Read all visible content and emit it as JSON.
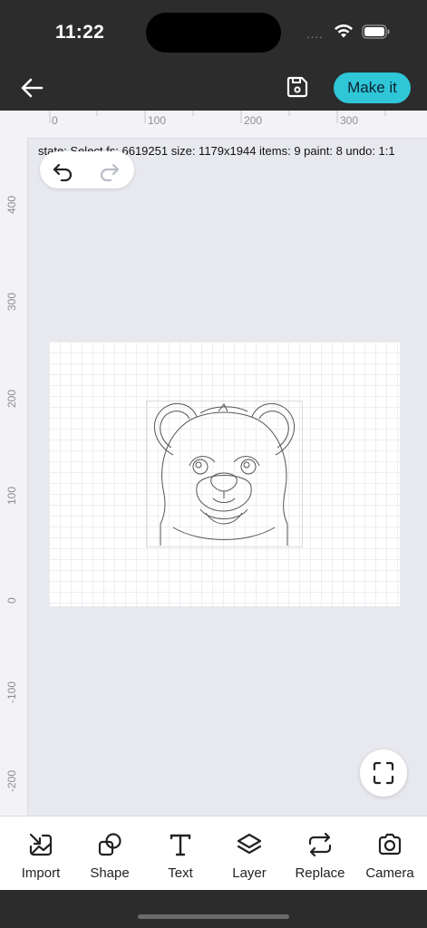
{
  "status_bar": {
    "time": "11:22",
    "signal": "...."
  },
  "header": {
    "make_it_label": "Make it"
  },
  "ruler": {
    "horizontal_labels": [
      "0",
      "100",
      "200",
      "300"
    ],
    "vertical_labels": [
      "400",
      "300",
      "200",
      "100",
      "0",
      "-100",
      "-200"
    ]
  },
  "canvas": {
    "info_text": "state: Select fs: 6619251 size: 1179x1944 items: 9 paint: 8 undo: 1:1"
  },
  "toolbar": {
    "items": [
      {
        "label": "Import",
        "icon": "import-icon"
      },
      {
        "label": "Shape",
        "icon": "shape-icon"
      },
      {
        "label": "Text",
        "icon": "text-icon"
      },
      {
        "label": "Layer",
        "icon": "layer-icon"
      },
      {
        "label": "Replace",
        "icon": "replace-icon"
      },
      {
        "label": "Camera",
        "icon": "camera-icon"
      }
    ]
  },
  "colors": {
    "accent": "#2fc6d8",
    "chrome": "#2c2c2c",
    "canvas_bg": "#e8e9ee"
  }
}
